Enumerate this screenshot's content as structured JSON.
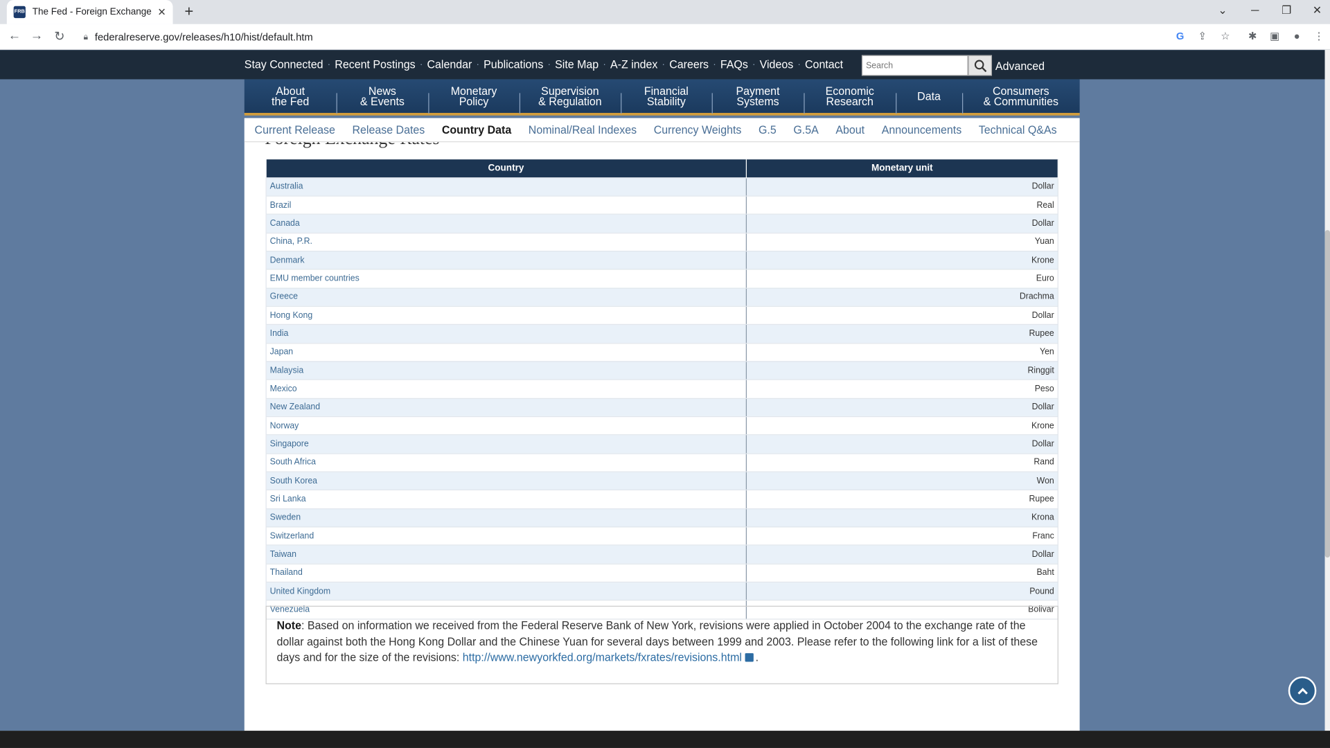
{
  "browser": {
    "tab_title": "The Fed - Foreign Exchange Rate",
    "favicon_text": "FRB",
    "url": "federalreserve.gov/releases/h10/hist/default.htm"
  },
  "utility_nav": [
    "Stay Connected",
    "Recent Postings",
    "Calendar",
    "Publications",
    "Site Map",
    "A-Z index",
    "Careers",
    "FAQs",
    "Videos",
    "Contact"
  ],
  "search": {
    "placeholder": "Search",
    "advanced_label": "Advanced"
  },
  "main_nav": [
    {
      "line1": "About",
      "line2": "the Fed"
    },
    {
      "line1": "News",
      "line2": "& Events"
    },
    {
      "line1": "Monetary",
      "line2": "Policy"
    },
    {
      "line1": "Supervision",
      "line2": "& Regulation"
    },
    {
      "line1": "Financial",
      "line2": "Stability"
    },
    {
      "line1": "Payment",
      "line2": "Systems"
    },
    {
      "line1": "Economic",
      "line2": "Research"
    },
    {
      "line1": "Data",
      "line2": ""
    },
    {
      "line1": "Consumers",
      "line2": "& Communities"
    }
  ],
  "sub_nav": [
    {
      "label": "Current Release",
      "active": false
    },
    {
      "label": "Release Dates",
      "active": false
    },
    {
      "label": "Country Data",
      "active": true
    },
    {
      "label": "Nominal/Real Indexes",
      "active": false
    },
    {
      "label": "Currency Weights",
      "active": false
    },
    {
      "label": "G.5",
      "active": false
    },
    {
      "label": "G.5A",
      "active": false
    },
    {
      "label": "About",
      "active": false
    },
    {
      "label": "Announcements",
      "active": false
    },
    {
      "label": "Technical Q&As",
      "active": false
    }
  ],
  "page_heading": "Foreign Exchange Rates",
  "table": {
    "headers": {
      "country": "Country",
      "unit": "Monetary unit"
    },
    "rows": [
      {
        "country": "Australia",
        "unit": "Dollar"
      },
      {
        "country": "Brazil",
        "unit": "Real"
      },
      {
        "country": "Canada",
        "unit": "Dollar"
      },
      {
        "country": "China, P.R.",
        "unit": "Yuan"
      },
      {
        "country": "Denmark",
        "unit": "Krone"
      },
      {
        "country": "EMU member countries",
        "unit": "Euro"
      },
      {
        "country": "Greece",
        "unit": "Drachma"
      },
      {
        "country": "Hong Kong",
        "unit": "Dollar"
      },
      {
        "country": "India",
        "unit": "Rupee"
      },
      {
        "country": "Japan",
        "unit": "Yen"
      },
      {
        "country": "Malaysia",
        "unit": "Ringgit"
      },
      {
        "country": "Mexico",
        "unit": "Peso"
      },
      {
        "country": "New Zealand",
        "unit": "Dollar"
      },
      {
        "country": "Norway",
        "unit": "Krone"
      },
      {
        "country": "Singapore",
        "unit": "Dollar"
      },
      {
        "country": "South Africa",
        "unit": "Rand"
      },
      {
        "country": "South Korea",
        "unit": "Won"
      },
      {
        "country": "Sri Lanka",
        "unit": "Rupee"
      },
      {
        "country": "Sweden",
        "unit": "Krona"
      },
      {
        "country": "Switzerland",
        "unit": "Franc"
      },
      {
        "country": "Taiwan",
        "unit": "Dollar"
      },
      {
        "country": "Thailand",
        "unit": "Baht"
      },
      {
        "country": "United Kingdom",
        "unit": "Pound"
      },
      {
        "country": "Venezuela",
        "unit": "Bolivar"
      }
    ]
  },
  "note": {
    "label": "Note",
    "text": ": Based on information we received from the Federal Reserve Bank of New York, revisions were applied in October 2004 to the exchange rate of the dollar against both the Hong Kong Dollar and the Chinese Yuan for several days between 1999 and 2003. Please refer to the following link for a list of these days and for the size of the revisions: ",
    "link": "http://www.newyorkfed.org/markets/fxrates/revisions.html",
    "end": "."
  },
  "colors": {
    "header_bg": "#1d2b3a",
    "nav_bg": "#264a73",
    "table_header": "#1c3552",
    "link": "#3d6b94",
    "page_bg": "#5f7b9f"
  }
}
